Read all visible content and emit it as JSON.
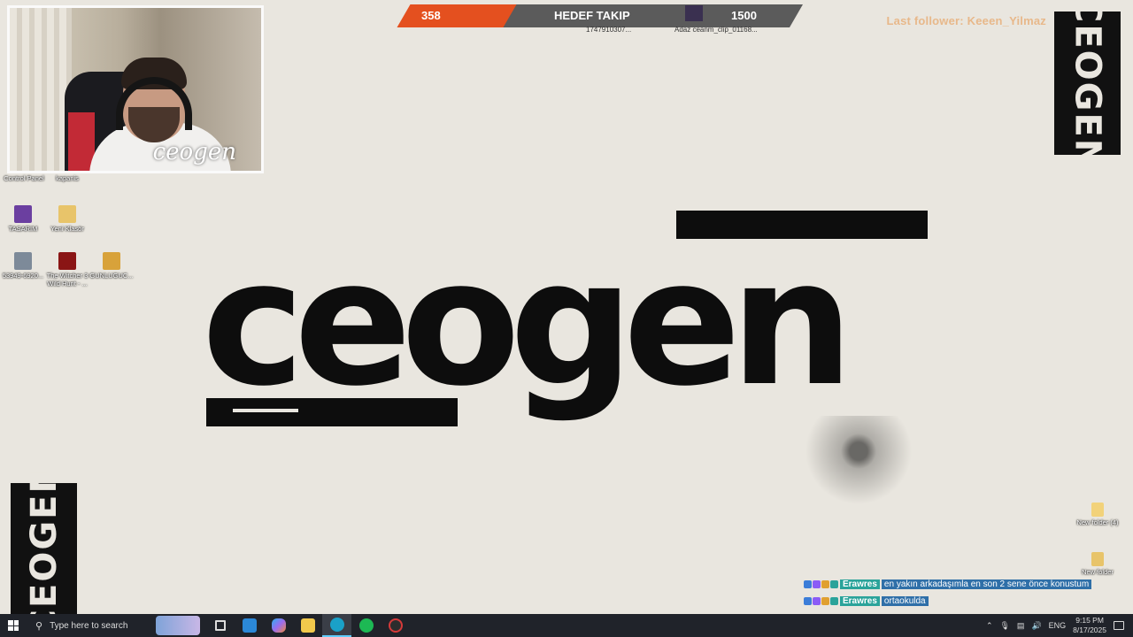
{
  "webcam": {
    "overlay_name": "ceogen"
  },
  "goal": {
    "current": "358",
    "title": "HEDEF TAKIP",
    "target": "1500",
    "sub_left": "1747910307...",
    "sub_right": "Adaz ceanm_clip_01168..."
  },
  "last_follower": "Last follower: Keeen_Yilmaz",
  "brand": "CEOGEN",
  "logo": {
    "text": "ceogen"
  },
  "desktop_icons": [
    {
      "label": "Control Panel",
      "color": "#4a7bd0"
    },
    {
      "label": "kapanis",
      "color": "#cfcfcf"
    },
    {
      "label": "TASARIM",
      "color": "#6b3fa0"
    },
    {
      "label": "Yeni Klasör",
      "color": "#e8c46a"
    },
    {
      "label": "53949-6920...",
      "color": "#7d8a99"
    },
    {
      "label": "The Witcher 3 Wild Hunt - ...",
      "color": "#8a1515"
    },
    {
      "label": "GUNLUGUC...",
      "color": "#d8a23a"
    },
    {
      "label": "New folder (4)",
      "color": "#f2d27a"
    },
    {
      "label": "New folder",
      "color": "#e8c46a"
    }
  ],
  "chat": [
    {
      "user": "Erawres",
      "message": "en yakın arkadaşımla en son 2 sene önce konustum"
    },
    {
      "user": "Erawres",
      "message": "ortaokulda"
    }
  ],
  "taskbar": {
    "search_placeholder": "Type here to search",
    "apps": [
      {
        "name": "task-view",
        "color": "#ffffff"
      },
      {
        "name": "store",
        "color": "#2b88d8"
      },
      {
        "name": "copilot",
        "color": "#9b6cf0"
      },
      {
        "name": "file-explorer",
        "color": "#f2c94c"
      },
      {
        "name": "edge",
        "color": "#1aa1c8"
      },
      {
        "name": "spotify",
        "color": "#1db954"
      },
      {
        "name": "obs",
        "color": "#d53a3a"
      }
    ],
    "language": "ENG",
    "time": "9:15 PM",
    "date": "8/17/2025"
  }
}
